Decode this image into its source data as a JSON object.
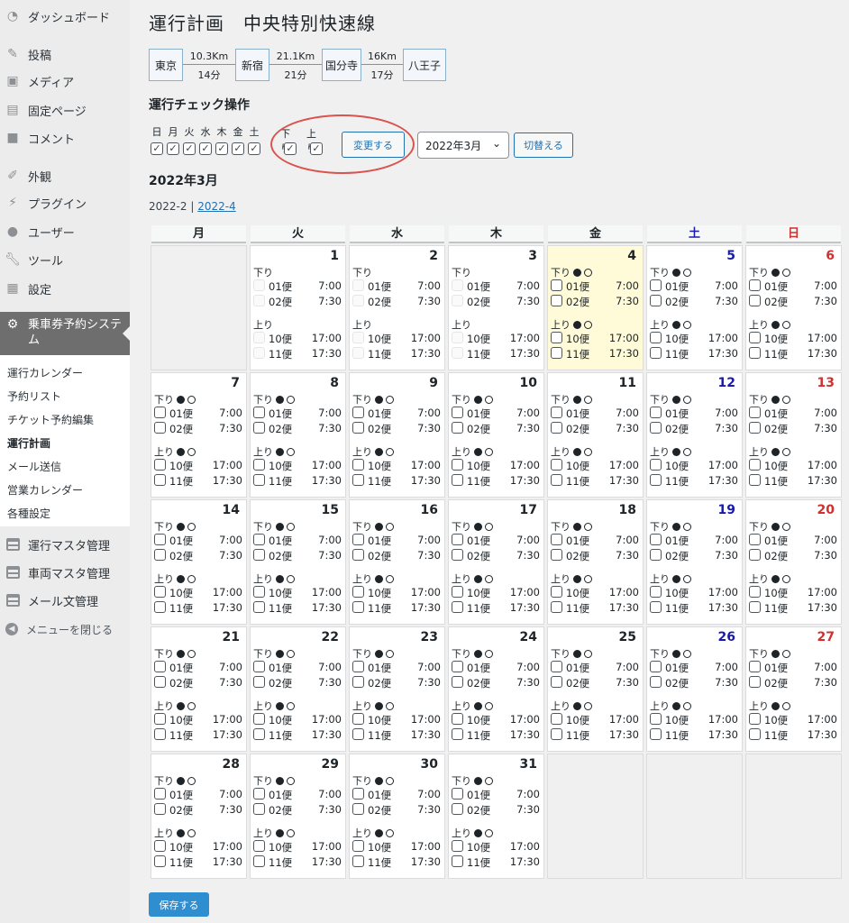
{
  "sidebar": {
    "items": [
      {
        "icon": "dashboard-icon",
        "label": "ダッシュボード"
      },
      {
        "icon": "pin-icon",
        "label": "投稿"
      },
      {
        "icon": "media-icon",
        "label": "メディア"
      },
      {
        "icon": "page-icon",
        "label": "固定ページ"
      },
      {
        "icon": "comment-icon",
        "label": "コメント"
      },
      {
        "icon": "brush-icon",
        "label": "外観"
      },
      {
        "icon": "plugin-icon",
        "label": "プラグイン"
      },
      {
        "icon": "user-icon",
        "label": "ユーザー"
      },
      {
        "icon": "wrench-icon",
        "label": "ツール"
      },
      {
        "icon": "settings-icon",
        "label": "設定"
      }
    ],
    "active": {
      "icon": "gear-icon",
      "label": "乗車券予約システム"
    },
    "submenu": [
      "運行カレンダー",
      "予約リスト",
      "チケット予約編集",
      "運行計画",
      "メール送信",
      "営業カレンダー",
      "各種設定"
    ],
    "submenu_current": "運行計画",
    "extra": [
      {
        "icon": "list-icon",
        "label": "運行マスタ管理"
      },
      {
        "icon": "list-icon",
        "label": "車両マスタ管理"
      },
      {
        "icon": "list-icon",
        "label": "メール文管理"
      }
    ],
    "collapse_label": "メニューを閉じる"
  },
  "page": {
    "title": "運行計画　中央特別快速線"
  },
  "route": {
    "stations": [
      "東京",
      "新宿",
      "国分寺",
      "八王子"
    ],
    "segments": [
      {
        "distance": "10.3Km",
        "time": "14分"
      },
      {
        "distance": "21.1Km",
        "time": "21分"
      },
      {
        "distance": "16Km",
        "time": "17分"
      }
    ]
  },
  "ops": {
    "title": "運行チェック操作",
    "weekdays": [
      "日",
      "月",
      "火",
      "水",
      "木",
      "金",
      "土"
    ],
    "directions": [
      "下り",
      "上り"
    ],
    "checkmark": "✓",
    "change_button": "変更する",
    "month_select": "2022年3月",
    "switch_button": "切替える"
  },
  "month": {
    "heading": "2022年3月",
    "prev": "2022-2",
    "separator": "|",
    "next": "2022-4"
  },
  "calendar": {
    "dow": [
      "月",
      "火",
      "水",
      "木",
      "金",
      "土",
      "日"
    ],
    "down_label": "下り",
    "up_label": "上り",
    "down_trips": [
      {
        "name": "01便",
        "time": "7:00"
      },
      {
        "name": "02便",
        "time": "7:30"
      }
    ],
    "up_trips": [
      {
        "name": "10便",
        "time": "17:00"
      },
      {
        "name": "11便",
        "time": "17:30"
      }
    ],
    "days_in_month": 31,
    "first_day_index": 1,
    "highlight_day": 4,
    "past_days": [
      1,
      2,
      3
    ]
  },
  "colors": {
    "saturday": "#1a1aa8",
    "sunday": "#d03030",
    "highlight": "#fffbd9",
    "accent": "#2271b1"
  },
  "save_button": "保存する"
}
